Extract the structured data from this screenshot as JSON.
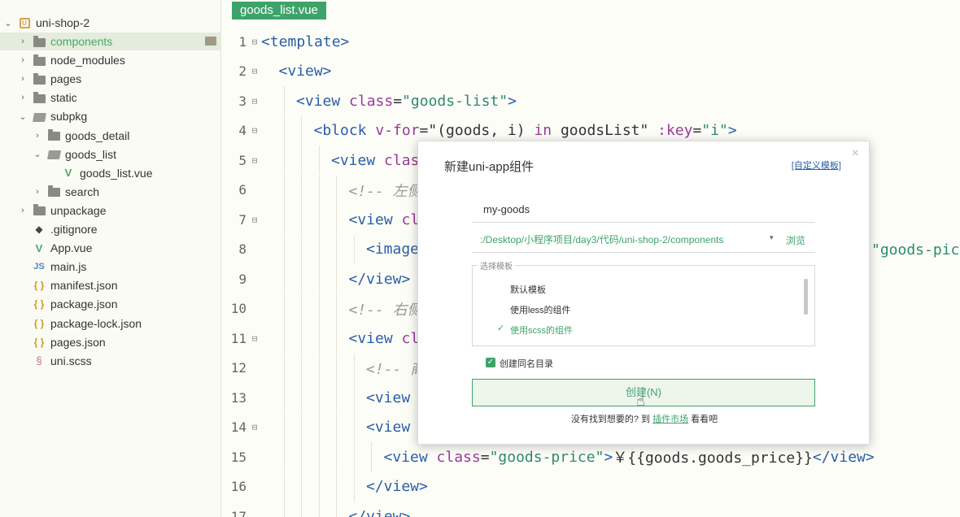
{
  "sidebar": {
    "project": "uni-shop-2",
    "items": [
      {
        "label": "components",
        "icon": "folder-icon",
        "indent": 1,
        "arrow": "›",
        "selected": true
      },
      {
        "label": "node_modules",
        "icon": "folder-icon",
        "indent": 1,
        "arrow": "›"
      },
      {
        "label": "pages",
        "icon": "folder-icon",
        "indent": 1,
        "arrow": "›"
      },
      {
        "label": "static",
        "icon": "folder-icon",
        "indent": 1,
        "arrow": "›"
      },
      {
        "label": "subpkg",
        "icon": "folder-open-icon",
        "indent": 1,
        "arrow": "⌄"
      },
      {
        "label": "goods_detail",
        "icon": "folder-icon",
        "indent": 2,
        "arrow": "›"
      },
      {
        "label": "goods_list",
        "icon": "folder-open-icon",
        "indent": 2,
        "arrow": "⌄"
      },
      {
        "label": "goods_list.vue",
        "icon": "vue-icon",
        "indent": 3,
        "arrow": ""
      },
      {
        "label": "search",
        "icon": "folder-icon",
        "indent": 2,
        "arrow": "›"
      },
      {
        "label": "unpackage",
        "icon": "folder-icon",
        "indent": 1,
        "arrow": "›"
      },
      {
        "label": ".gitignore",
        "icon": "git-icon",
        "indent": 1,
        "arrow": ""
      },
      {
        "label": "App.vue",
        "icon": "vue-icon",
        "indent": 1,
        "arrow": ""
      },
      {
        "label": "main.js",
        "icon": "js-icon",
        "indent": 1,
        "arrow": ""
      },
      {
        "label": "manifest.json",
        "icon": "json-icon",
        "indent": 1,
        "arrow": ""
      },
      {
        "label": "package.json",
        "icon": "json-icon",
        "indent": 1,
        "arrow": ""
      },
      {
        "label": "package-lock.json",
        "icon": "json-icon",
        "indent": 1,
        "arrow": ""
      },
      {
        "label": "pages.json",
        "icon": "json-icon",
        "indent": 1,
        "arrow": ""
      },
      {
        "label": "uni.scss",
        "icon": "scss-icon",
        "indent": 1,
        "arrow": ""
      }
    ]
  },
  "editor": {
    "tab": "goods_list.vue",
    "lines": [
      {
        "n": "1",
        "fold": true,
        "indent": 0,
        "parts": [
          [
            "tg",
            "<template>"
          ]
        ]
      },
      {
        "n": "2",
        "fold": true,
        "indent": 1,
        "parts": [
          [
            "tg",
            "<view>"
          ]
        ]
      },
      {
        "n": "3",
        "fold": true,
        "indent": 2,
        "parts": [
          [
            "tg",
            "<view "
          ],
          [
            "at",
            "class"
          ],
          [
            "tx",
            "="
          ],
          [
            "st",
            "\"goods-list\""
          ],
          [
            "tg",
            ">"
          ]
        ]
      },
      {
        "n": "4",
        "fold": true,
        "indent": 3,
        "parts": [
          [
            "tg",
            "<block "
          ],
          [
            "at",
            "v-for"
          ],
          [
            "tx",
            "=\"(goods, i) "
          ],
          [
            "at",
            "in"
          ],
          [
            "tx",
            " goodsList\" "
          ],
          [
            "at",
            ":key"
          ],
          [
            "tx",
            "="
          ],
          [
            "st",
            "\"i\""
          ],
          [
            "tg",
            ">"
          ]
        ]
      },
      {
        "n": "5",
        "fold": true,
        "indent": 4,
        "parts": [
          [
            "tg",
            "<view "
          ],
          [
            "at",
            "clas"
          ]
        ]
      },
      {
        "n": "6",
        "fold": false,
        "indent": 5,
        "parts": [
          [
            "cm",
            "<!-- 左侧"
          ]
        ]
      },
      {
        "n": "7",
        "fold": true,
        "indent": 5,
        "parts": [
          [
            "tg",
            "<view "
          ],
          [
            "at",
            "cl"
          ]
        ]
      },
      {
        "n": "8",
        "fold": false,
        "indent": 6,
        "parts": [
          [
            "tg",
            "<image"
          ]
        ]
      },
      {
        "n": "9",
        "fold": false,
        "indent": 5,
        "parts": [
          [
            "tg",
            "</view>"
          ]
        ]
      },
      {
        "n": "10",
        "fold": false,
        "indent": 5,
        "parts": [
          [
            "cm",
            "<!-- 右侧"
          ]
        ]
      },
      {
        "n": "11",
        "fold": true,
        "indent": 5,
        "parts": [
          [
            "tg",
            "<view "
          ],
          [
            "at",
            "cl"
          ]
        ]
      },
      {
        "n": "12",
        "fold": false,
        "indent": 6,
        "parts": [
          [
            "cm",
            "<!-- 商"
          ]
        ]
      },
      {
        "n": "13",
        "fold": false,
        "indent": 6,
        "parts": [
          [
            "tg",
            "<view"
          ]
        ]
      },
      {
        "n": "14",
        "fold": true,
        "indent": 6,
        "parts": [
          [
            "tg",
            "<view"
          ]
        ]
      },
      {
        "n": "15",
        "fold": false,
        "indent": 7,
        "parts": [
          [
            "tg",
            "<view "
          ],
          [
            "at",
            "class"
          ],
          [
            "tx",
            "="
          ],
          [
            "st",
            "\"goods-price\""
          ],
          [
            "tg",
            ">"
          ],
          [
            "tx",
            "￥{{goods.goods_price}}"
          ],
          [
            "tg",
            "</view>"
          ]
        ]
      },
      {
        "n": "16",
        "fold": false,
        "indent": 6,
        "parts": [
          [
            "tg",
            "</view>"
          ]
        ]
      },
      {
        "n": "17",
        "fold": false,
        "indent": 5,
        "parts": [
          [
            "tg",
            "</view>"
          ]
        ]
      }
    ],
    "right_snippet": "\"goods-pic\""
  },
  "dialog": {
    "title": "新建uni-app组件",
    "custom_template_link": "[自定义模板]",
    "close": "×",
    "name_value": "my-goods",
    "path_value": ":/Desktop/小程序项目/day3/代码/uni-shop-2/components",
    "path_arrow": "▾",
    "browse": "浏览",
    "template_legend": "选择模板",
    "templates": [
      "默认模板",
      "使用less的组件",
      "使用scss的组件"
    ],
    "selected_template_check": "✓",
    "create_dir_check": "✓",
    "create_dir_label": "创建同名目录",
    "create_button": "创建(N)",
    "footer_prefix": "没有找到想要的? 到",
    "footer_link": "插件市场",
    "footer_suffix": "看看吧"
  },
  "colors": {
    "accent": "#3da36a",
    "tag": "#2a5ea8",
    "attribute": "#9a3a9a",
    "string": "#2d8a6e"
  }
}
